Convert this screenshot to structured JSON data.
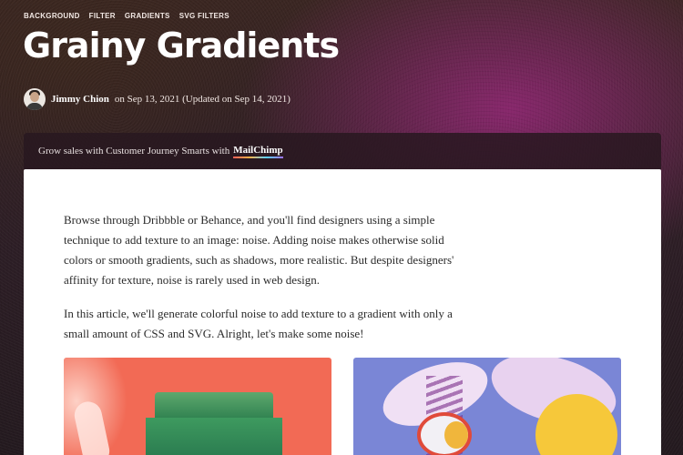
{
  "tags": [
    "BACKGROUND",
    "FILTER",
    "GRADIENTS",
    "SVG FILTERS"
  ],
  "title": "Grainy Gradients",
  "byline": {
    "author": "Jimmy Chion",
    "date_text": "on Sep 13, 2021 (Updated on Sep 14, 2021)"
  },
  "promo": {
    "text": "Grow sales with Customer Journey Smarts with",
    "link": "MailChimp"
  },
  "article": {
    "paragraphs": [
      "Browse through Dribbble or Behance, and you'll find designers using a simple technique to add texture to an image: noise. Adding noise makes otherwise solid colors or smooth gradients, such as shadows, more realistic. But despite designers' affinity for texture, noise is rarely used in web design.",
      "In this article, we'll generate colorful noise to add texture to a gradient with only a small amount of CSS and SVG. Alright, let's make some noise!"
    ]
  },
  "colors": {
    "accent": "#8e2a7a",
    "image1_bg": "#f26a55",
    "image2_bg": "#7a86d6"
  }
}
